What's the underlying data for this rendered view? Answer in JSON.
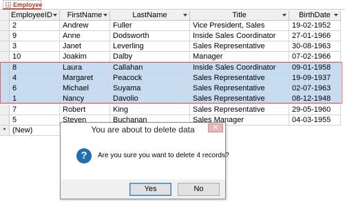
{
  "tab": {
    "label": "Employee"
  },
  "columns": [
    "EmployeeID",
    "FirstName",
    "LastName",
    "Title",
    "BirthDate"
  ],
  "rows": [
    [
      "2",
      "Andrew",
      "Fuller",
      "Vice President, Sales",
      "19-02-1952"
    ],
    [
      "9",
      "Anne",
      "Dodsworth",
      "Inside Sales Coordinator",
      "27-01-1966"
    ],
    [
      "3",
      "Janet",
      "Leverling",
      "Sales Representative",
      "30-08-1963"
    ],
    [
      "10",
      "Joakim",
      "Dalby",
      "Manager",
      "07-02-1966"
    ],
    [
      "8",
      "Laura",
      "Callahan",
      "Inside Sales Coordinator",
      "09-01-1958"
    ],
    [
      "4",
      "Margaret",
      "Peacock",
      "Sales Representative",
      "19-09-1937"
    ],
    [
      "6",
      "Michael",
      "Suyama",
      "Sales Representative",
      "02-07-1963"
    ],
    [
      "1",
      "Nancy",
      "Davolio",
      "Sales Representative",
      "08-12-1948"
    ],
    [
      "7",
      "Robert",
      "King",
      "Sales Representative",
      "29-05-1960"
    ],
    [
      "5",
      "Steven",
      "Buchanan",
      "Sales Manager",
      "04-03-1955"
    ]
  ],
  "selected_rows": [
    4,
    5,
    6,
    7
  ],
  "new_row": {
    "marker": "*",
    "label": "(New)"
  },
  "dialog": {
    "title": "You are about to delete data",
    "message": "Are you sure you want to delete 4 records?",
    "yes_label": "Yes",
    "no_label": "No",
    "close_glyph": "✕",
    "icon_glyph": "?"
  },
  "colors": {
    "selection": "#c5dcf2",
    "selection_border": "#e06060",
    "tab_accent": "#c0392b",
    "question_icon": "#1e6fb8"
  }
}
